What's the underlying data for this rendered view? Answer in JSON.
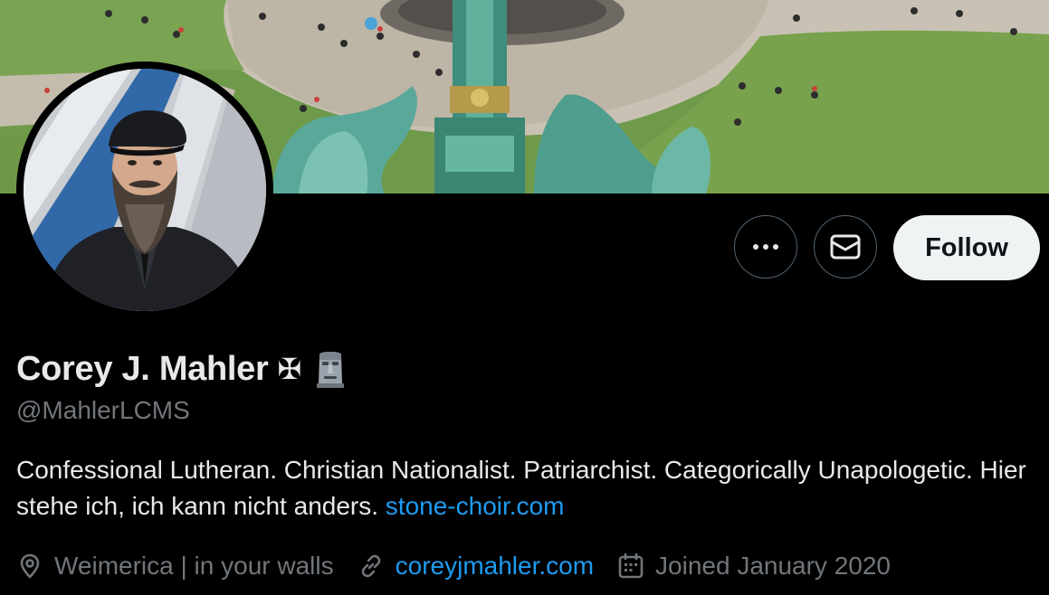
{
  "profile": {
    "display_name": "Corey J. Mahler",
    "name_symbol": "✠",
    "name_emoji": "moai-emoji",
    "handle": "@MahlerLCMS",
    "bio_text": "Confessional Lutheran. Christian Nationalist. Patriarchist. Categorically Unapologetic. Hier stehe ich, ich kann nicht anders. ",
    "bio_link": "stone-choir.com",
    "location": "Weimerica | in your walls",
    "website": "coreyjmahler.com",
    "joined": "Joined January 2020"
  },
  "actions": {
    "more_icon": "more-horizontal-icon",
    "message_icon": "envelope-icon",
    "follow_label": "Follow"
  },
  "icons": {
    "location": "location-pin-icon",
    "website": "link-icon",
    "joined": "calendar-icon"
  },
  "colors": {
    "background": "#000000",
    "text_primary": "#e7e9ea",
    "text_secondary": "#71767b",
    "link": "#1d9bf0",
    "follow_bg": "#eff3f4",
    "follow_text": "#0f1419",
    "button_border": "#536471"
  }
}
